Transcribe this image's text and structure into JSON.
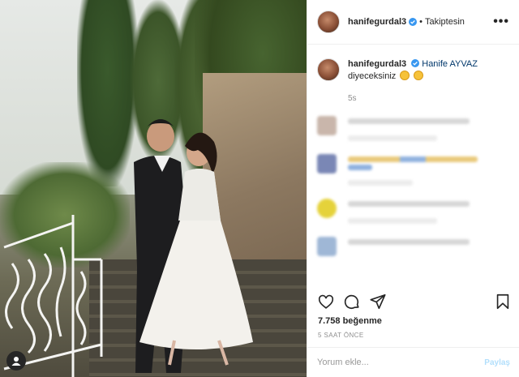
{
  "post": {
    "username": "hanifegurdal3",
    "separator": "•",
    "follow_status": "Takiptesin",
    "more_label": "•••",
    "caption_mention": "Hanife AYVAZ",
    "caption_text": "diyeceksiniz",
    "caption_time": "5s",
    "likes": "7.758 beğenme",
    "time_ago": "5 SAAT ÖNCE",
    "comment_placeholder": "Yorum ekle...",
    "post_label": "Paylaş"
  },
  "icons": {
    "verified": "verified-badge-icon",
    "like": "heart-icon",
    "comment": "speech-bubble-icon",
    "share": "paper-plane-icon",
    "save": "bookmark-icon",
    "photo_user": "user-tag-icon"
  },
  "colors": {
    "verified_blue": "#3897f0",
    "link_blue": "#00376b",
    "post_button_disabled": "#b2dffc"
  }
}
